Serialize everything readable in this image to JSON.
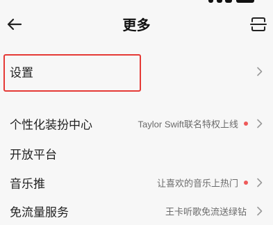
{
  "header": {
    "title": "更多",
    "back_icon": "back-arrow-icon",
    "scan_icon": "scan-icon"
  },
  "rows": [
    {
      "label": "设置",
      "sub": "",
      "dot": false,
      "chevron": true
    },
    {
      "label": "个性化装扮中心",
      "sub": "Taylor Swift联名特权上线",
      "dot": true,
      "chevron": true
    },
    {
      "label": "开放平台",
      "sub": "",
      "dot": false,
      "chevron": false
    },
    {
      "label": "音乐推",
      "sub": "让喜欢的音乐上热门",
      "dot": true,
      "chevron": true
    },
    {
      "label": "免流量服务",
      "sub": "王卡听歌免流送绿钻",
      "dot": false,
      "chevron": true
    }
  ],
  "colors": {
    "background": "#f7f7f7",
    "highlight": "#e53935",
    "notification_dot": "#ee5a5a",
    "text": "#222222",
    "subtext": "#6a6a6a"
  }
}
